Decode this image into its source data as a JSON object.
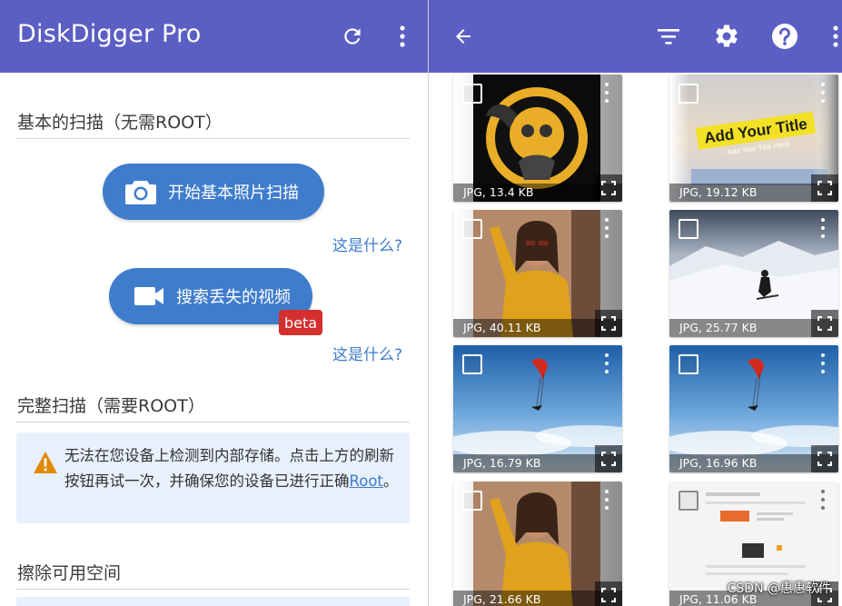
{
  "left": {
    "app_title": "DiskDigger Pro",
    "icons": {
      "refresh": "refresh-icon",
      "overflow": "more-vert-icon"
    },
    "basic_scan_title": "基本的扫描（无需ROOT）",
    "photo_scan_label": "开始基本照片扫描",
    "what_is_1": "这是什么?",
    "video_scan_label": "搜索丢失的视频",
    "beta_badge": "beta",
    "what_is_2": "这是什么?",
    "full_scan_title": "完整扫描（需要ROOT）",
    "warning_text": "无法在您设备上检测到内部存储。点击上方的刷新按钮再试一次，并确保您的设备已进行正确",
    "warning_link": "Root",
    "warning_end": "。",
    "wipe_title": "擦除可用空间"
  },
  "right": {
    "icons": {
      "back": "back-arrow-icon",
      "filter": "filter-icon",
      "settings": "gear-icon",
      "help": "help-icon",
      "overflow": "more-vert-icon"
    },
    "files": [
      {
        "caption": "JPG, 13.4 KB",
        "thumb": "monkey-logo"
      },
      {
        "caption": "JPG, 19.12 KB",
        "thumb": "add-your-title"
      },
      {
        "caption": "JPG, 40.11 KB",
        "thumb": "woman-yellow-sweater"
      },
      {
        "caption": "JPG, 25.77 KB",
        "thumb": "skier-mountain"
      },
      {
        "caption": "JPG, 16.79 KB",
        "thumb": "paraglider-sky"
      },
      {
        "caption": "JPG, 16.96 KB",
        "thumb": "paraglider-sky"
      },
      {
        "caption": "JPG, 21.66 KB",
        "thumb": "woman-yellow-sweater"
      },
      {
        "caption": "JPG, 11.06 KB",
        "thumb": "document-screenshot"
      }
    ],
    "title_overlay": "Add Your Title",
    "title_overlay_sub": "Add Your Title Here"
  },
  "colors": {
    "appbar": "#5b5fc3",
    "accent": "#3f7ccc",
    "beta": "#d32f2f",
    "warning_bg": "#e8f0fc",
    "warning_icon": "#e08a00"
  },
  "watermark": "CSDN @惠惠软件"
}
